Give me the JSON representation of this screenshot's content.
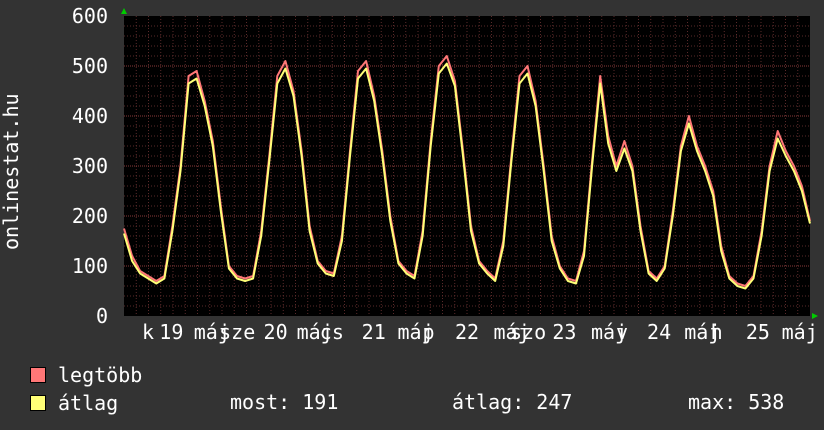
{
  "chart_data": {
    "type": "line",
    "ylabel": "onlinestat.hu",
    "ylim": [
      0,
      600
    ],
    "yticks": [
      0,
      100,
      200,
      300,
      400,
      500,
      600
    ],
    "xticks": [
      {
        "label": "k",
        "pos": 0.035
      },
      {
        "label": "19",
        "pos": 0.069
      },
      {
        "label": "máj",
        "pos": 0.128
      },
      {
        "label": "sze",
        "pos": 0.165
      },
      {
        "label": "20",
        "pos": 0.221
      },
      {
        "label": "máj",
        "pos": 0.278
      },
      {
        "label": "cs",
        "pos": 0.303
      },
      {
        "label": "21",
        "pos": 0.364
      },
      {
        "label": "máj",
        "pos": 0.425
      },
      {
        "label": "p",
        "pos": 0.444
      },
      {
        "label": "22",
        "pos": 0.5
      },
      {
        "label": "máj",
        "pos": 0.565
      },
      {
        "label": "szo",
        "pos": 0.589
      },
      {
        "label": "23",
        "pos": 0.642
      },
      {
        "label": "máj",
        "pos": 0.707
      },
      {
        "label": "v",
        "pos": 0.726
      },
      {
        "label": "24",
        "pos": 0.78
      },
      {
        "label": "máj",
        "pos": 0.843
      },
      {
        "label": "h",
        "pos": 0.864
      },
      {
        "label": "25",
        "pos": 0.924
      },
      {
        "label": "máj",
        "pos": 0.985
      }
    ],
    "x": [
      0,
      0.01,
      0.02,
      0.03,
      0.04,
      0.05,
      0.06,
      0.07,
      0.08,
      0.09,
      0.1,
      0.11,
      0.12,
      0.13,
      0.14,
      0.15,
      0.16,
      0.17,
      0.18,
      0.19,
      0.2,
      0.21,
      0.22,
      0.23,
      0.24,
      0.25,
      0.26,
      0.27,
      0.28,
      0.29,
      0.3,
      0.31,
      0.32,
      0.33,
      0.34,
      0.35,
      0.36,
      0.37,
      0.38,
      0.39,
      0.4,
      0.41,
      0.42,
      0.43,
      0.44,
      0.45,
      0.46,
      0.47,
      0.48,
      0.49,
      0.5,
      0.51,
      0.52,
      0.53,
      0.54,
      0.55,
      0.56,
      0.57,
      0.58,
      0.59,
      0.6,
      0.61,
      0.62,
      0.63,
      0.64,
      0.65,
      0.66,
      0.67,
      0.68,
      0.69,
      0.7,
      0.71,
      0.72,
      0.73,
      0.74,
      0.75,
      0.76,
      0.77,
      0.78,
      0.79,
      0.8,
      0.81,
      0.82,
      0.83,
      0.84,
      0.85,
      0.86,
      0.87,
      0.88,
      0.89,
      0.9,
      0.91,
      0.92,
      0.93,
      0.94,
      0.95,
      0.96,
      0.97,
      0.98,
      0.99,
      1.0
    ],
    "series": [
      {
        "name": "legtöbb",
        "color": "#ff7777",
        "values": [
          175,
          120,
          90,
          80,
          70,
          80,
          180,
          300,
          480,
          490,
          430,
          350,
          220,
          100,
          80,
          75,
          80,
          170,
          320,
          480,
          510,
          450,
          330,
          180,
          110,
          90,
          85,
          160,
          330,
          490,
          510,
          440,
          330,
          200,
          110,
          90,
          80,
          170,
          350,
          500,
          520,
          470,
          330,
          180,
          110,
          90,
          75,
          150,
          320,
          480,
          500,
          430,
          300,
          160,
          100,
          75,
          70,
          130,
          310,
          480,
          360,
          300,
          350,
          300,
          180,
          90,
          75,
          100,
          210,
          340,
          400,
          340,
          300,
          250,
          140,
          80,
          65,
          60,
          80,
          170,
          300,
          370,
          330,
          300,
          260,
          190
        ]
      },
      {
        "name": "átlag",
        "color": "#ffff77",
        "values": [
          165,
          110,
          85,
          75,
          65,
          75,
          170,
          290,
          465,
          475,
          420,
          340,
          210,
          95,
          75,
          70,
          75,
          160,
          310,
          465,
          495,
          440,
          320,
          170,
          105,
          85,
          80,
          150,
          320,
          475,
          495,
          430,
          320,
          190,
          105,
          85,
          75,
          160,
          340,
          485,
          505,
          460,
          320,
          170,
          105,
          85,
          70,
          140,
          310,
          465,
          485,
          420,
          290,
          150,
          95,
          70,
          65,
          120,
          300,
          465,
          345,
          290,
          335,
          290,
          170,
          85,
          70,
          95,
          200,
          330,
          385,
          330,
          290,
          240,
          130,
          75,
          60,
          55,
          75,
          160,
          290,
          355,
          320,
          290,
          250,
          185
        ]
      }
    ]
  },
  "legend": {
    "max_label": "legtöbb",
    "avg_label": "átlag"
  },
  "stats": {
    "now": "most: 191",
    "avg": "átlag: 247",
    "max": "max: 538"
  }
}
